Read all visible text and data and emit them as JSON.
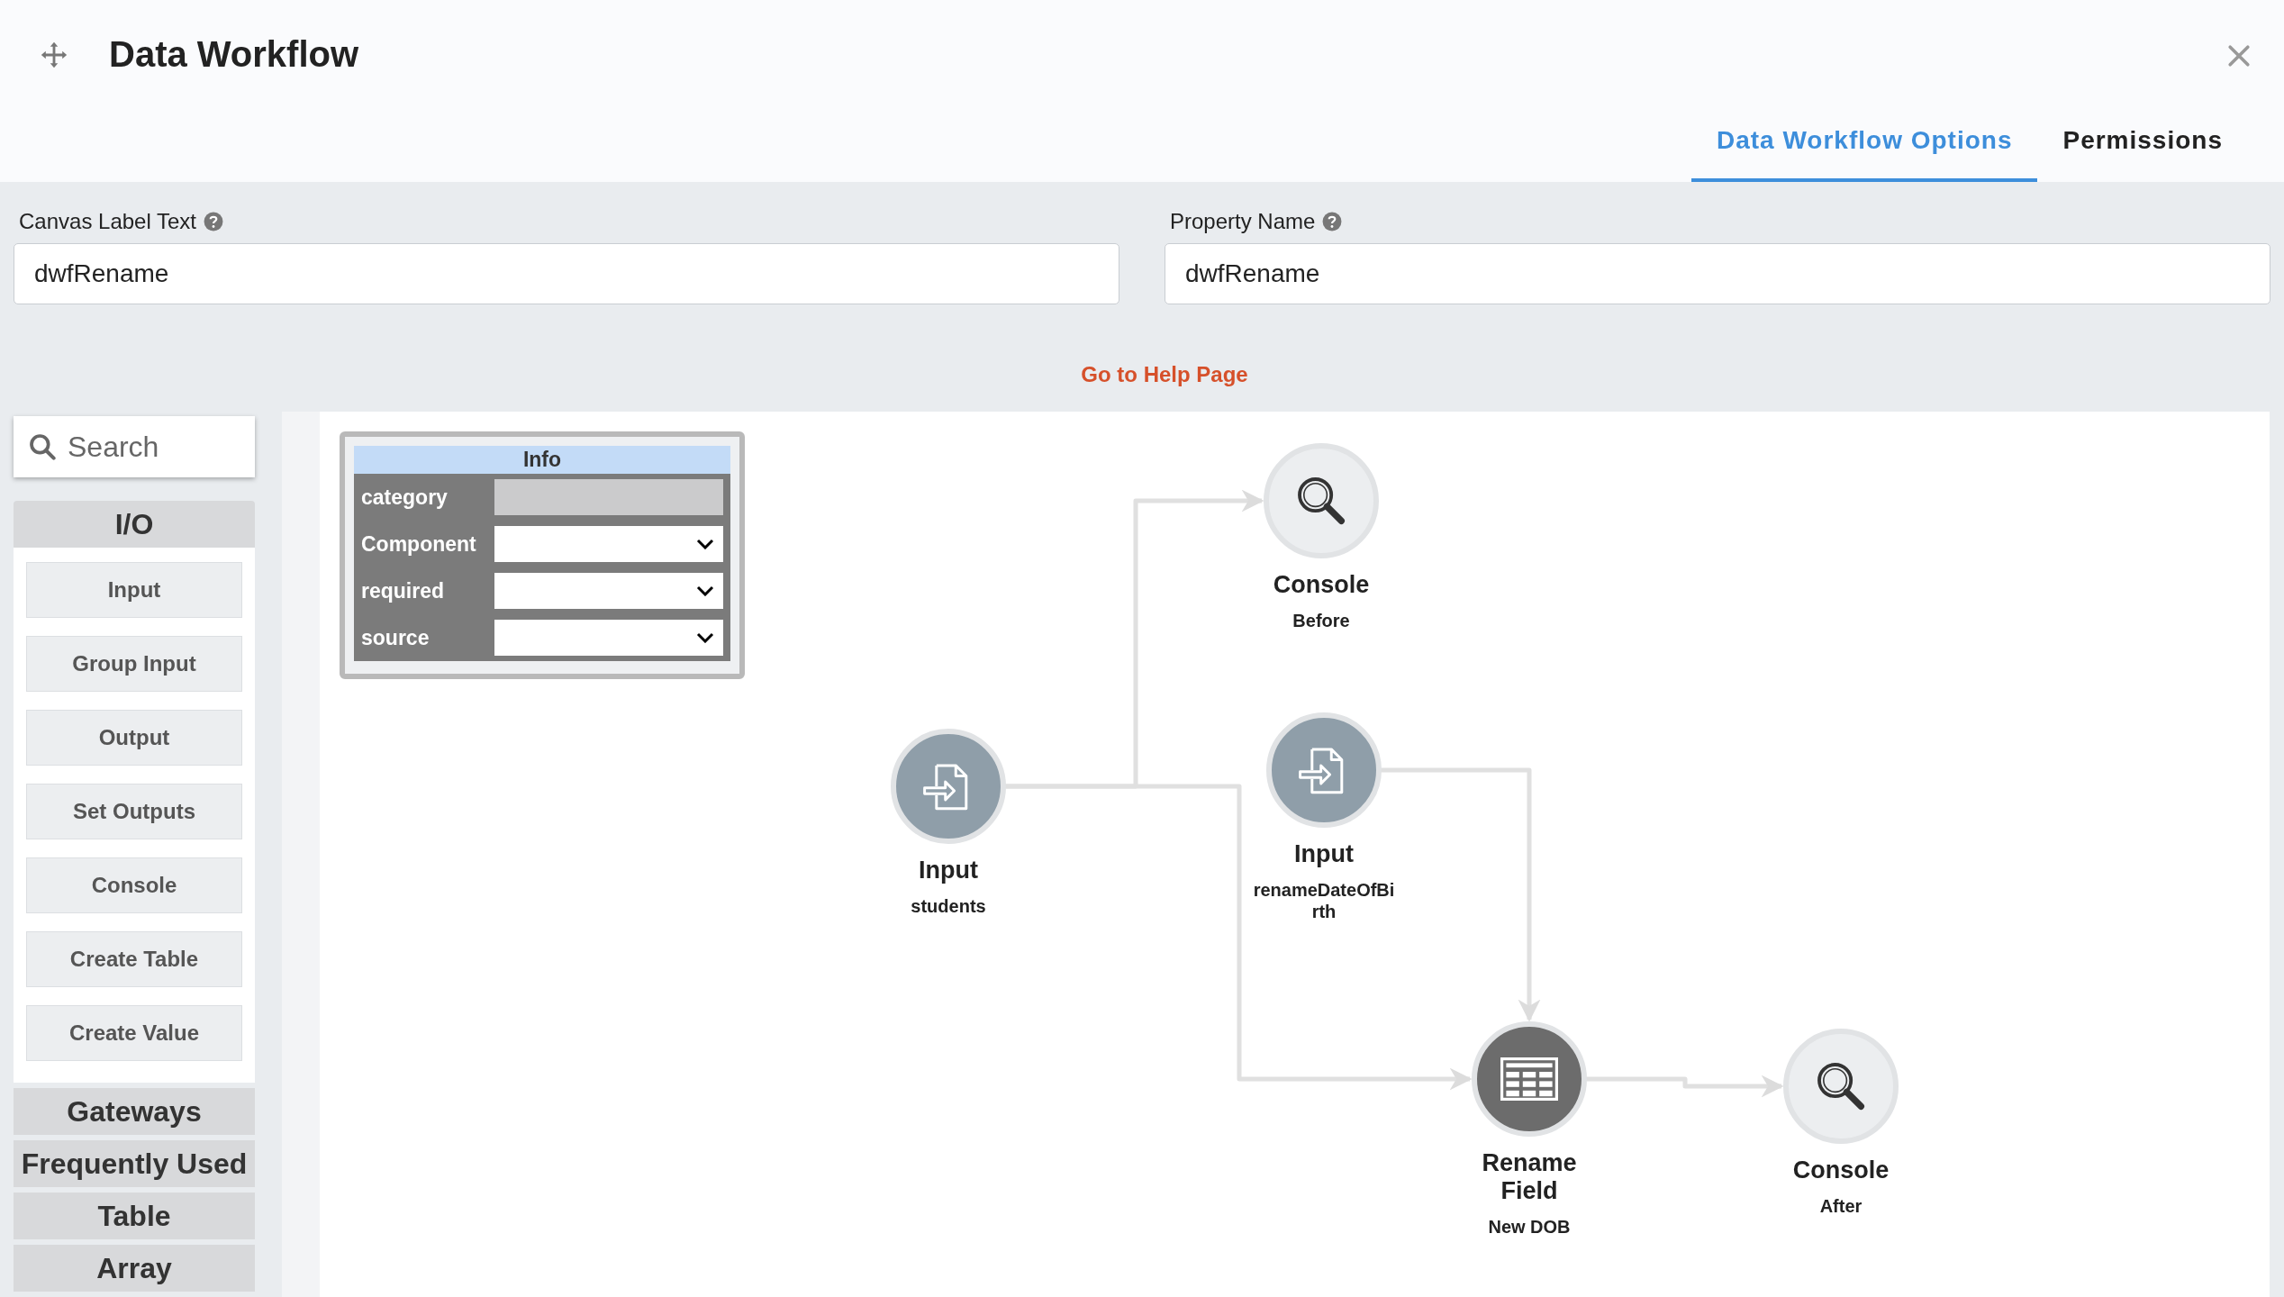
{
  "window": {
    "title": "Data Workflow"
  },
  "tabs": [
    {
      "label": "Data Workflow Options",
      "selected": true
    },
    {
      "label": "Permissions",
      "selected": false
    }
  ],
  "form": {
    "fields": [
      {
        "label": "Canvas Label Text",
        "value": "dwfRename"
      },
      {
        "label": "Property Name",
        "value": "dwfRename"
      }
    ],
    "help_link": "Go to Help Page"
  },
  "palette": {
    "search": {
      "placeholder": "Search"
    },
    "sections": [
      {
        "title": "I/O",
        "expanded": true,
        "items": [
          "Input",
          "Group Input",
          "Output",
          "Set Outputs",
          "Console",
          "Create Table",
          "Create Value"
        ]
      },
      {
        "title": "Gateways",
        "expanded": false
      },
      {
        "title": "Frequently Used",
        "expanded": false
      },
      {
        "title": "Table",
        "expanded": false
      },
      {
        "title": "Array",
        "expanded": false
      }
    ]
  },
  "info_panel": {
    "title": "Info",
    "fields": [
      {
        "label": "category",
        "kind": "text",
        "disabled": true
      },
      {
        "label": "Component",
        "kind": "select",
        "disabled": false
      },
      {
        "label": "required",
        "kind": "select",
        "disabled": false
      },
      {
        "label": "source",
        "kind": "select",
        "disabled": false
      }
    ]
  },
  "nodes": [
    {
      "kind": "console",
      "title": "Console",
      "subtitle": "Before"
    },
    {
      "kind": "input",
      "title": "Input",
      "subtitle": "students"
    },
    {
      "kind": "input",
      "title": "Input",
      "subtitle": "renameDateOfBi rth"
    },
    {
      "kind": "rename_field",
      "title": "Rename Field",
      "subtitle": "New DOB"
    },
    {
      "kind": "console",
      "title": "Console",
      "subtitle": "After"
    }
  ]
}
